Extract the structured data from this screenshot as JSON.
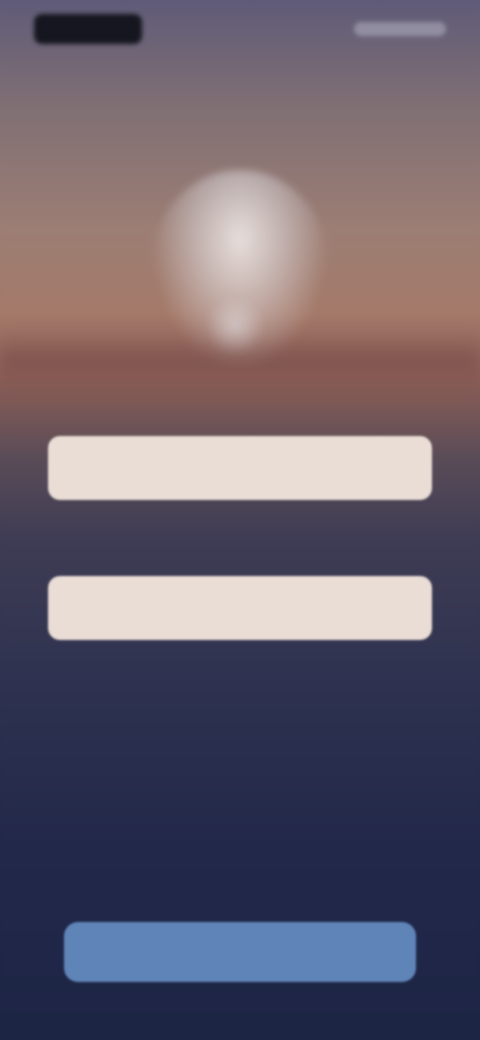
{
  "status_bar": {
    "logo_icon": "brand-logo",
    "right_indicators": "status-indicators"
  },
  "hero": {
    "image": "moon-over-horizon"
  },
  "form": {
    "hint": "",
    "field1": {
      "label": "",
      "placeholder": "",
      "value": ""
    },
    "field2": {
      "label": "",
      "placeholder": "",
      "value": ""
    },
    "link1": "",
    "link2": "",
    "submit_label": ""
  },
  "colors": {
    "field_bg": "#e9ddd6",
    "button_bg": "#5f84b8",
    "background_top": "#5f5b78",
    "background_bottom": "#1d2545"
  }
}
